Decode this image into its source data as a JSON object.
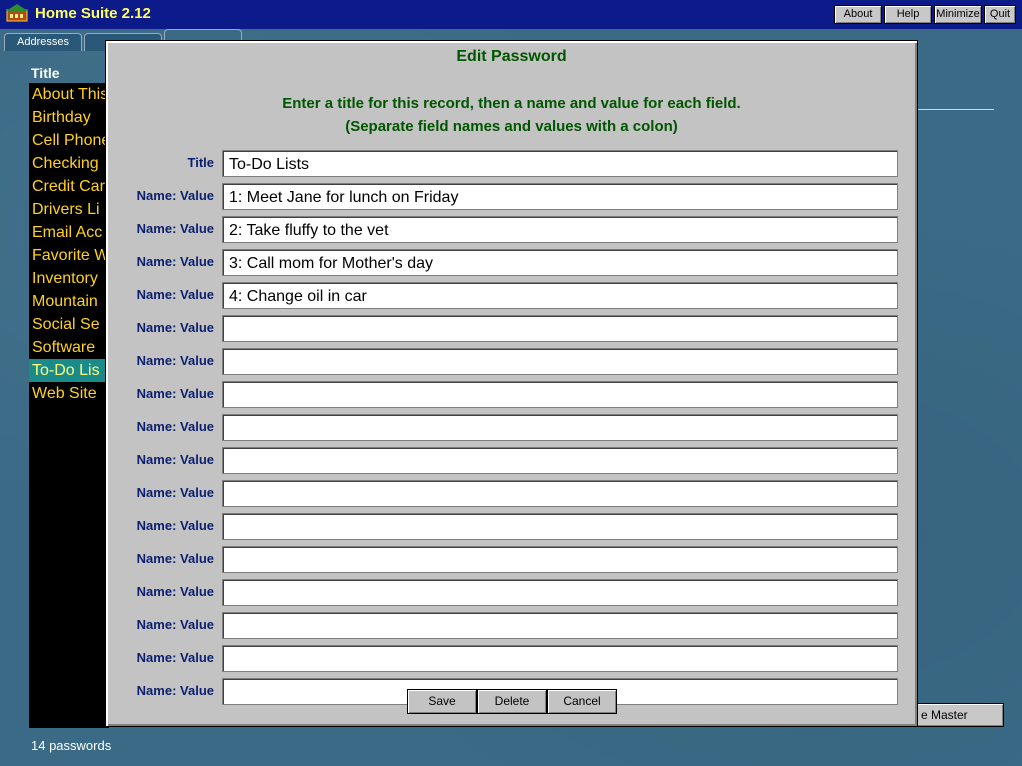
{
  "app": {
    "title": "Home Suite 2.12"
  },
  "top_buttons": {
    "about": "About",
    "help": "Help",
    "minimize": "Minimize",
    "quit": "Quit"
  },
  "tabs": [
    {
      "label": "Addresses"
    },
    {
      "label": ""
    },
    {
      "label": ""
    }
  ],
  "list": {
    "header": "Title",
    "items": [
      {
        "label": "About This"
      },
      {
        "label": "Birthday"
      },
      {
        "label": "Cell Phone"
      },
      {
        "label": "Checking"
      },
      {
        "label": "Credit Card"
      },
      {
        "label": "Drivers Li"
      },
      {
        "label": "Email Acc"
      },
      {
        "label": "Favorite W"
      },
      {
        "label": "Inventory"
      },
      {
        "label": "Mountain"
      },
      {
        "label": "Social Se"
      },
      {
        "label": "Software"
      },
      {
        "label": "To-Do Lis",
        "selected": true
      },
      {
        "label": "Web Site"
      }
    ],
    "count": "14 passwords"
  },
  "master_button": {
    "label": "e Master"
  },
  "dialog": {
    "title": "Edit Password",
    "instruction_line1": "Enter a title for this record, then a name and value for each field.",
    "instruction_line2": "(Separate field names and values with a colon)",
    "title_label": "Title",
    "title_value": "To-Do Lists",
    "field_label": "Name: Value",
    "fields": [
      "1: Meet Jane for lunch on Friday",
      "2: Take fluffy to the vet",
      "3: Call mom for Mother's day",
      "4: Change oil in car",
      "",
      "",
      "",
      "",
      "",
      "",
      "",
      "",
      "",
      "",
      "",
      ""
    ],
    "buttons": {
      "save": "Save",
      "delete": "Delete",
      "cancel": "Cancel"
    }
  },
  "colors": {
    "titlebar": "#0c1a8a",
    "title_text": "#ffff66",
    "list_text": "#ffd21e",
    "dialog_heading": "#005500",
    "label_text": "#0b1f6e",
    "desktop": "#3a6a86"
  },
  "icons": {
    "app": "home-suite-icon"
  }
}
